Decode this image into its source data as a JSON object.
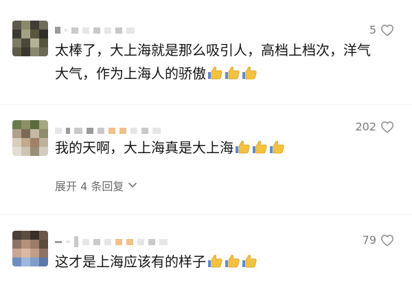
{
  "comments": [
    {
      "text": "太棒了，大上海就是那么吸引人，高档上档次，洋气大气，作为上海人的骄傲",
      "emoji": [
        "thumbs-up-icon",
        "thumbs-up-icon",
        "thumbs-up-icon"
      ],
      "likes": "5"
    },
    {
      "text": "我的天啊，大上海真是大上海",
      "emoji": [
        "thumbs-up-icon",
        "thumbs-up-icon",
        "thumbs-up-icon"
      ],
      "likes": "202",
      "expand_replies": "展开 4 条回复"
    },
    {
      "text": "这才是上海应该有的样子",
      "emoji": [
        "thumbs-up-icon",
        "thumbs-up-icon",
        "thumbs-up-icon"
      ],
      "likes": "79"
    }
  ],
  "icons": {
    "like": "heart-outline-icon",
    "expand": "chevron-down-icon"
  },
  "colors": {
    "meta_gray": "#7b7b7b",
    "thumb_yellow": "#f5c23c"
  }
}
